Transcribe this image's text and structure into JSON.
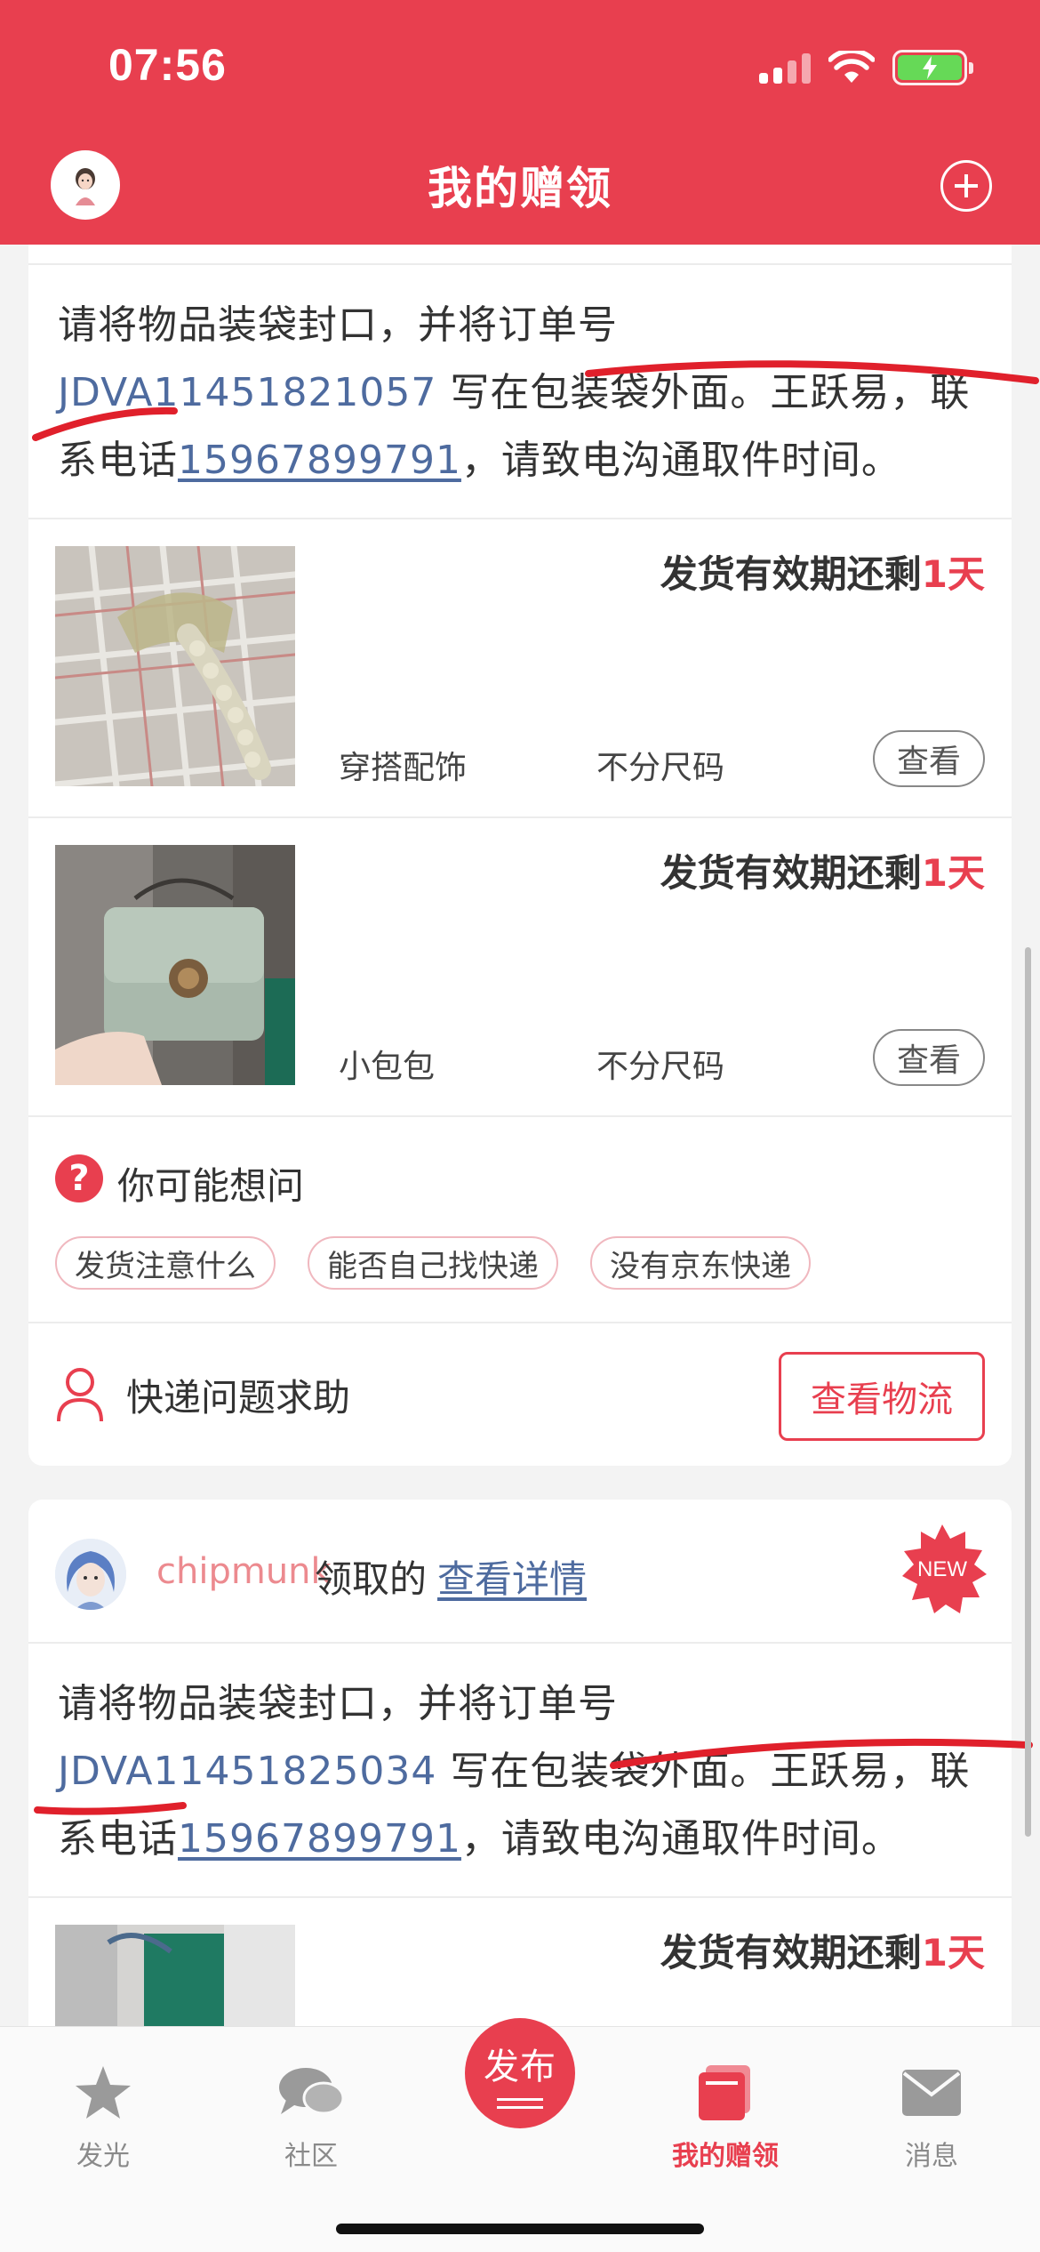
{
  "status_bar": {
    "time": "07:56"
  },
  "header": {
    "title": "我的赠领"
  },
  "card1": {
    "notice": {
      "prefix": "请将物品装袋封口，并将订单号 ",
      "order_no": "JDVA11451821057",
      "middle": " 写在包装袋外面。王跃易，联系电话",
      "phone": "15967899791",
      "suffix": "，请致电沟通取件时间。"
    },
    "items": [
      {
        "deadline_prefix": "发货有效期还剩",
        "deadline_days": "1天",
        "category": "穿搭配饰",
        "size": "不分尺码",
        "view_label": "查看",
        "thumb": "hair-clip-photo"
      },
      {
        "deadline_prefix": "发货有效期还剩",
        "deadline_days": "1天",
        "category": "小包包",
        "size": "不分尺码",
        "view_label": "查看",
        "thumb": "bag-photo"
      }
    ],
    "faq": {
      "title": "你可能想问",
      "tags": [
        "发货注意什么",
        "能否自己找快递",
        "没有京东快递"
      ]
    },
    "help": {
      "label": "快递问题求助",
      "button": "查看物流"
    }
  },
  "card2": {
    "username": "chipmunk",
    "claimed_text": "领取的",
    "detail_link": "查看详情",
    "badge": "NEW",
    "notice": {
      "prefix": "请将物品装袋封口，并将订单号 ",
      "order_no": "JDVA11451825034",
      "middle": " 写在包装袋外面。王跃易，联系电话",
      "phone": "15967899791",
      "suffix": "，请致电沟通取件时间。"
    },
    "items": [
      {
        "deadline_prefix": "发货有效期还剩",
        "deadline_days": "1天"
      }
    ]
  },
  "tabbar": {
    "tabs": [
      {
        "label": "发光",
        "icon": "star-icon"
      },
      {
        "label": "社区",
        "icon": "chat-bubbles-icon"
      },
      {
        "label": "发布",
        "icon": "publish-button"
      },
      {
        "label": "我的赠领",
        "icon": "gift-cards-icon",
        "active": true
      },
      {
        "label": "消息",
        "icon": "envelope-icon"
      }
    ]
  },
  "colors": {
    "brand_red": "#e83f4f",
    "link_blue": "#4e6b9f",
    "background": "#f3f3f3"
  }
}
